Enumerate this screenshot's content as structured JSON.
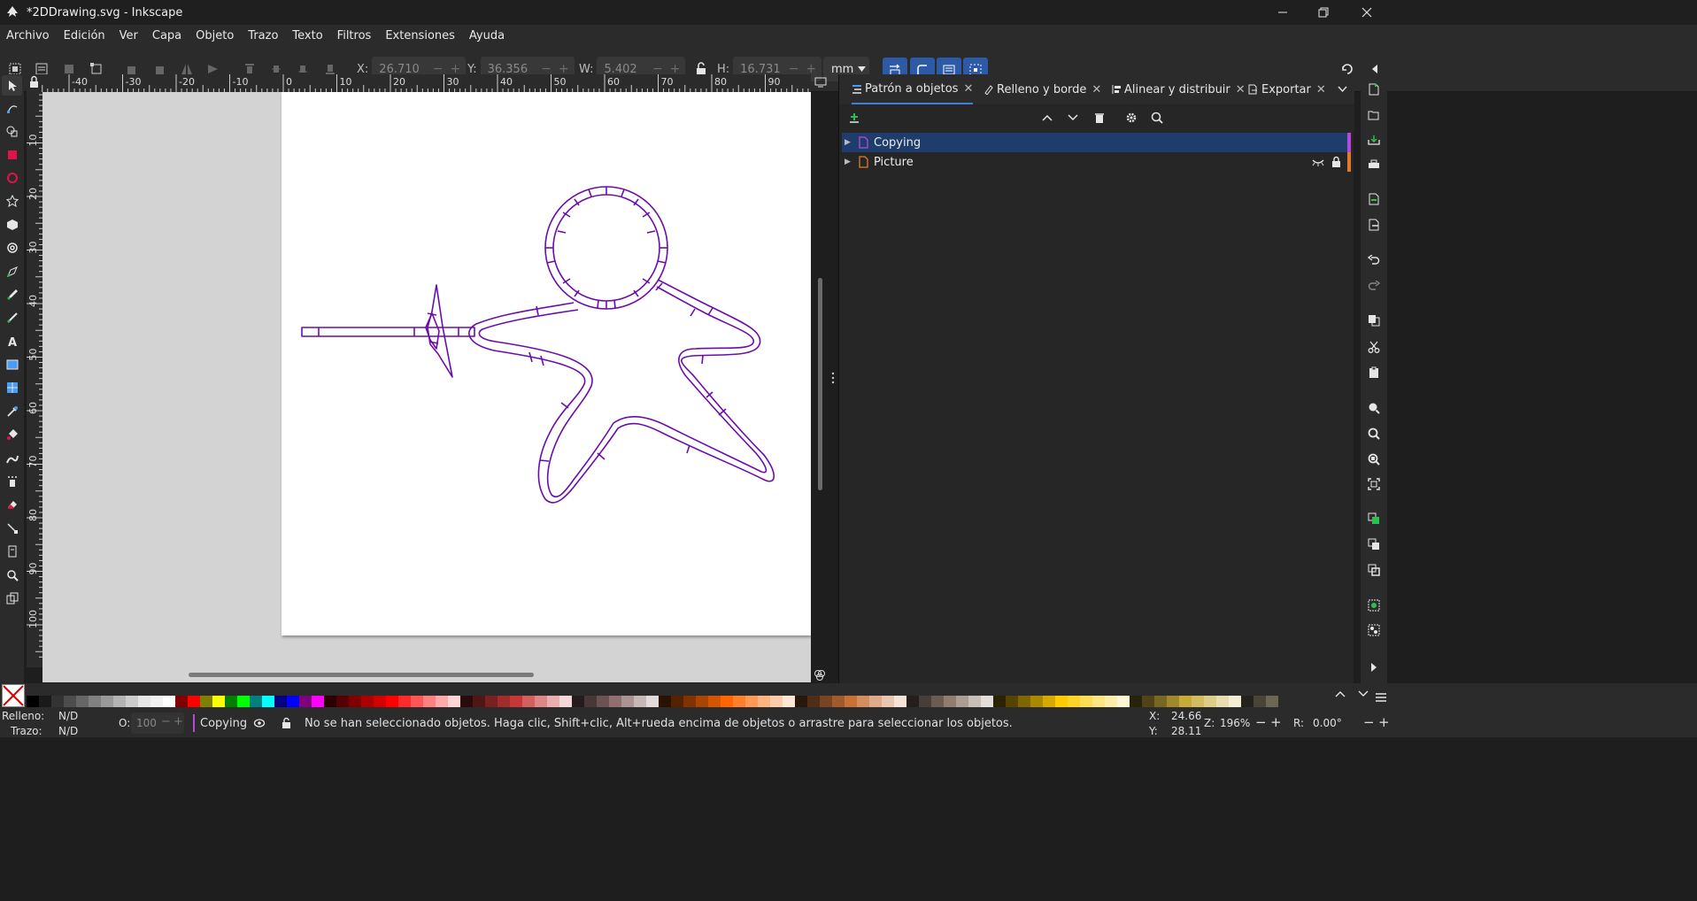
{
  "window": {
    "title": "*2DDrawing.svg - Inkscape"
  },
  "menu": [
    "Archivo",
    "Edición",
    "Ver",
    "Capa",
    "Objeto",
    "Trazo",
    "Texto",
    "Filtros",
    "Extensiones",
    "Ayuda"
  ],
  "toolbar": {
    "x_label": "X:",
    "x_value": "26.710",
    "y_label": "Y:",
    "y_value": "36.356",
    "w_label": "W:",
    "w_value": "5.402",
    "h_label": "H:",
    "h_value": "16.731",
    "unit": "mm"
  },
  "ruler": {
    "h_labels": [
      "-40",
      "-30",
      "-20",
      "-10",
      "0",
      "10",
      "20",
      "30",
      "40",
      "50",
      "60",
      "70",
      "80",
      "90"
    ],
    "v_labels": [
      "10",
      "20",
      "30",
      "40",
      "50",
      "60",
      "70",
      "80",
      "90",
      "100"
    ]
  },
  "panel": {
    "tabs": [
      {
        "label": "Patrón a objetos",
        "active": true
      },
      {
        "label": "Relleno y borde",
        "active": false
      },
      {
        "label": "Alinear y distribuir",
        "active": false
      },
      {
        "label": "Exportar",
        "active": false
      }
    ],
    "layers": [
      {
        "name": "Copying",
        "selected": true,
        "color": "#b44bd6"
      },
      {
        "name": "Picture",
        "selected": false,
        "color": "#e07a2e"
      }
    ]
  },
  "drawing": {
    "stroke_color": "#6a0dad"
  },
  "statusbar": {
    "fill_label": "Relleno:",
    "fill_value": "N/D",
    "stroke_label": "Trazo:",
    "stroke_value": "N/D",
    "opacity_label": "O:",
    "opacity_value": "100",
    "layer_name": "Copying",
    "message": "No se han seleccionado objetos. Haga clic, Shift+clic, Alt+rueda encima de objetos o arrastre para seleccionar los objetos.",
    "cursor_x_label": "X:",
    "cursor_x": "24.66",
    "cursor_y_label": "Y:",
    "cursor_y": "28.11",
    "zoom_label": "Z:",
    "zoom": "196%",
    "rotation_label": "R:",
    "rotation": "0.00°"
  },
  "palette": {
    "colors": [
      "#000000",
      "#1a1a1a",
      "#333333",
      "#4d4d4d",
      "#666666",
      "#808080",
      "#999999",
      "#b3b3b3",
      "#cccccc",
      "#e6e6e6",
      "#f2f2f2",
      "#ffffff",
      "#800000",
      "#ff0000",
      "#808000",
      "#ffff00",
      "#008000",
      "#00ff00",
      "#008080",
      "#00ffff",
      "#000080",
      "#0000ff",
      "#800080",
      "#ff00ff",
      "#2b0000",
      "#550000",
      "#800000",
      "#aa0000",
      "#d40000",
      "#ff0000",
      "#ff2a2a",
      "#ff5555",
      "#ff8080",
      "#ffaaaa",
      "#ffd5d5",
      "#280b0b",
      "#501616",
      "#782121",
      "#a02c2c",
      "#c83737",
      "#d35f5f",
      "#de8787",
      "#e9afaf",
      "#f4d7d7",
      "#241c1c",
      "#483737",
      "#6c5353",
      "#916f6f",
      "#ac9393",
      "#c8b7b7",
      "#e3dbdb",
      "#2b1100",
      "#552200",
      "#803300",
      "#aa4400",
      "#d45500",
      "#ff6600",
      "#ff7f2a",
      "#ff9955",
      "#ffb380",
      "#ffccaa",
      "#ffe6d5",
      "#28170b",
      "#502d16",
      "#784421",
      "#a05a2c",
      "#c87137",
      "#d38d5f",
      "#deaa87",
      "#e9c6af",
      "#f4e3d7",
      "#241f1c",
      "#483e37",
      "#6c5d53",
      "#917c6f",
      "#ac9d93",
      "#c8beb7",
      "#e3dedb",
      "#2b2200",
      "#554400",
      "#806600",
      "#aa8800",
      "#d4aa00",
      "#ffcc00",
      "#ffd42a",
      "#ffdd55",
      "#ffe680",
      "#ffeeaa",
      "#fff6d5",
      "#28220b",
      "#504416",
      "#786721",
      "#a0892c",
      "#c8ab37",
      "#d3bc5f",
      "#decd87",
      "#e9ddaf",
      "#f4eed7",
      "#24221c",
      "#484537",
      "#6c6753"
    ]
  }
}
